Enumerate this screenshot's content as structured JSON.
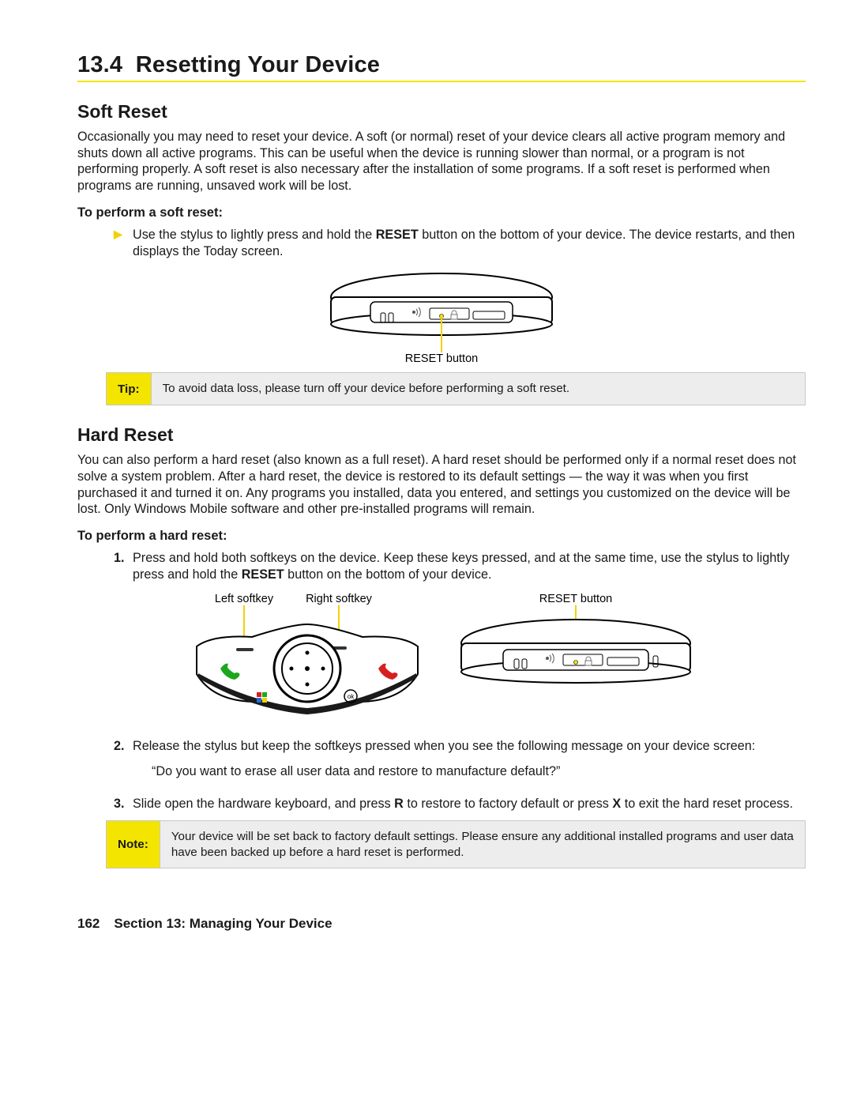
{
  "section": {
    "number": "13.4",
    "title": "Resetting Your Device"
  },
  "soft": {
    "heading": "Soft Reset",
    "body": "Occasionally you may need to reset your device. A soft (or normal) reset of your device clears all active program memory and shuts down all active programs. This can be useful when the device is running slower than normal, or a program is not performing properly. A soft reset is also necessary after the installation of some programs. If a soft reset is performed when programs are running, unsaved work will be lost.",
    "procHead": "To perform a soft reset:",
    "step_pre": "Use the stylus to lightly press and hold the ",
    "step_bold": "RESET",
    "step_post": " button on the bottom of your device. The device restarts, and then displays the Today screen.",
    "caption": "RESET button",
    "tipLabel": "Tip:",
    "tipBody": "To avoid data loss, please turn off your device before performing a soft reset."
  },
  "hard": {
    "heading": "Hard Reset",
    "body": "You can also perform a hard reset (also known as a full reset). A hard reset should be performed only if a normal reset does not solve a system problem. After a hard reset, the device is restored to its default settings — the way it was when you first purchased it and turned it on. Any programs you installed, data you entered, and settings you customized on the device will be lost. Only Windows Mobile software and other pre-installed programs will remain.",
    "procHead": "To perform a hard reset:",
    "s1_marker": "1.",
    "s1_pre": "Press and hold both softkeys on the device. Keep these keys pressed, and at the same time, use the stylus to lightly press and hold the ",
    "s1_bold": "RESET",
    "s1_post": " button on the bottom of your device.",
    "labels": {
      "leftSoftkey": "Left softkey",
      "rightSoftkey": "Right softkey",
      "resetButton": "RESET button"
    },
    "s2_marker": "2.",
    "s2_text": "Release the stylus but keep the softkeys pressed when you see the following message on your device screen:",
    "s2_quote": "“Do you want to erase all user data and restore to manufacture default?”",
    "s3_marker": "3.",
    "s3_pre": "Slide open the hardware keyboard, and press ",
    "s3_boldR": "R",
    "s3_mid": " to restore to factory default or press ",
    "s3_boldX": "X",
    "s3_post": " to exit the hard reset process.",
    "noteLabel": "Note:",
    "noteBody": "Your device will be set back to factory default settings. Please ensure any additional installed programs and user data have been backed up before a hard reset is performed."
  },
  "footer": {
    "pageNum": "162",
    "sectionLabel": "Section 13: Managing Your Device"
  },
  "colors": {
    "accent": "#f3e500"
  }
}
